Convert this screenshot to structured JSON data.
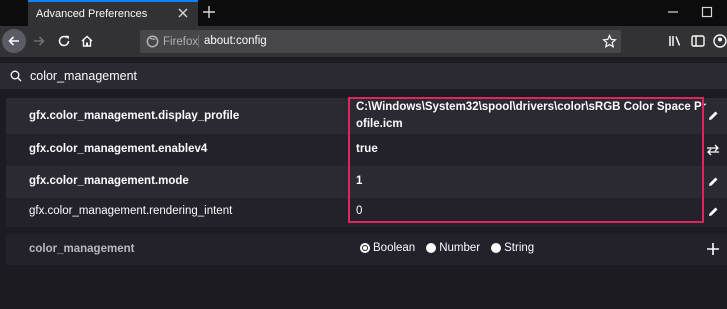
{
  "tab": {
    "title": "Advanced Preferences"
  },
  "urlbar": {
    "identity": "Firefox",
    "url": "about:config"
  },
  "search": {
    "value": "color_management"
  },
  "prefs": [
    {
      "name": "gfx.color_management.display_profile",
      "value_line1": "C:\\Windows\\System32\\spool\\drivers\\color\\sRGB Color Space Pr",
      "value_line2": "ofile.icm",
      "modified": true,
      "action": "edit-icon"
    },
    {
      "name": "gfx.color_management.enablev4",
      "value": "true",
      "modified": true,
      "action": "toggle-icon"
    },
    {
      "name": "gfx.color_management.mode",
      "value": "1",
      "modified": true,
      "action": "edit-icon"
    },
    {
      "name": "gfx.color_management.rendering_intent",
      "value": "0",
      "modified": false,
      "action": "edit-icon"
    }
  ],
  "add_pref": {
    "name": "color_management",
    "types": [
      "Boolean",
      "Number",
      "String"
    ],
    "selected_type": "Boolean"
  },
  "colors": {
    "highlight": "#e0245e",
    "accent": "#0a84ff"
  }
}
